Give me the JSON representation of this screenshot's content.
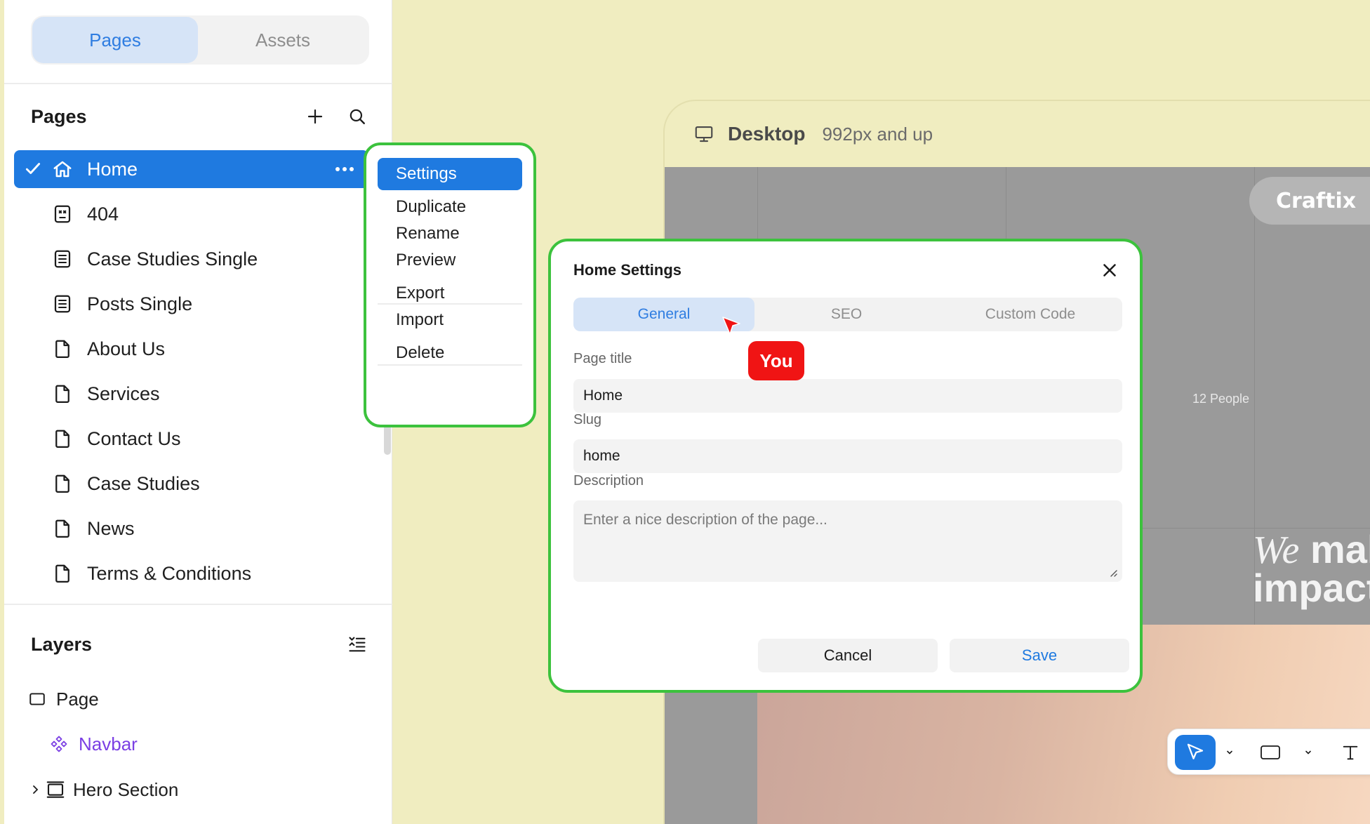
{
  "sidebar": {
    "tabs": [
      {
        "label": "Pages",
        "active": true
      },
      {
        "label": "Assets",
        "active": false
      }
    ],
    "pages_section_title": "Pages",
    "pages": [
      {
        "label": "Home",
        "icon": "home-icon",
        "selected": true
      },
      {
        "label": "404",
        "icon": "error-page-icon"
      },
      {
        "label": "Case Studies Single",
        "icon": "template-page-icon"
      },
      {
        "label": "Posts Single",
        "icon": "template-page-icon"
      },
      {
        "label": "About Us",
        "icon": "page-icon"
      },
      {
        "label": "Services",
        "icon": "page-icon"
      },
      {
        "label": "Contact Us",
        "icon": "page-icon"
      },
      {
        "label": "Case Studies",
        "icon": "page-icon"
      },
      {
        "label": "News",
        "icon": "page-icon"
      },
      {
        "label": "Terms & Conditions",
        "icon": "page-icon"
      }
    ],
    "layers_section_title": "Layers",
    "layers": [
      {
        "label": "Page",
        "icon": "square-icon"
      },
      {
        "label": "Navbar",
        "icon": "component-icon",
        "color": "#7b3fe4"
      },
      {
        "label": "Hero Section",
        "icon": "section-icon",
        "expandable": true
      }
    ]
  },
  "context_menu": {
    "items": [
      "Settings",
      "Duplicate",
      "Rename",
      "Preview",
      "Export",
      "Import",
      "Delete"
    ],
    "active": "Settings"
  },
  "canvas": {
    "breakpoint_title": "Desktop",
    "breakpoint_sub": "992px and up",
    "brand": "Craftix",
    "people_text": "12 People",
    "hero_line1_italic": "We",
    "hero_line1_rest": "mal",
    "hero_line2": "impact"
  },
  "modal": {
    "title": "Home Settings",
    "tabs": [
      {
        "label": "General",
        "active": true
      },
      {
        "label": "SEO",
        "active": false
      },
      {
        "label": "Custom Code",
        "active": false
      }
    ],
    "page_title_label": "Page title",
    "page_title_value": "Home",
    "slug_label": "Slug",
    "slug_value": "home",
    "description_label": "Description",
    "description_placeholder": "Enter a nice description of the page...",
    "cancel_label": "Cancel",
    "save_label": "Save"
  },
  "cursor": {
    "label": "You"
  },
  "colors": {
    "accent": "#1f7ae0",
    "highlight_border": "#3cc23d",
    "cursor_red": "#f01414",
    "canvas_bg": "#f0edc0"
  }
}
